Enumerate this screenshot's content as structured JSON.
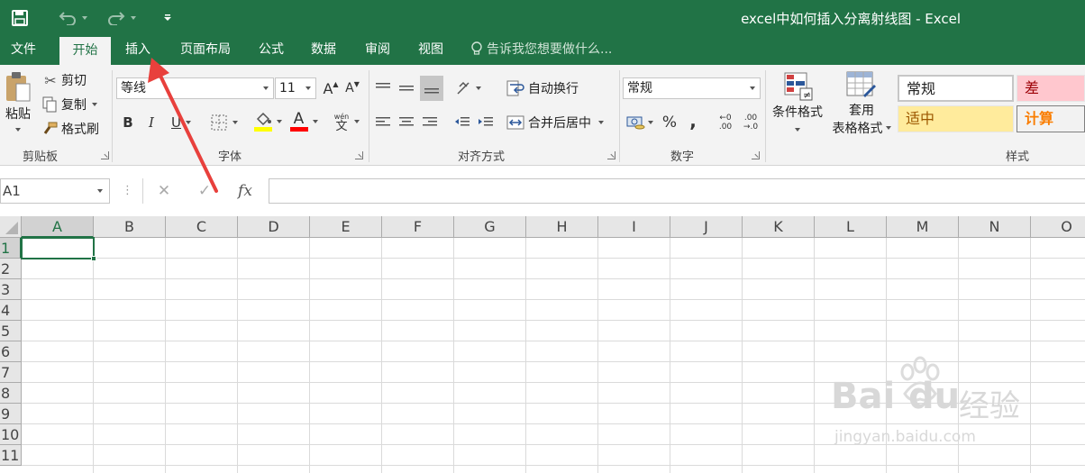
{
  "window": {
    "title": "excel中如何插入分离射线图 - Excel"
  },
  "qat": {
    "save_icon": "save-icon",
    "undo_icon": "undo-icon",
    "redo_icon": "redo-icon",
    "customize_icon": "customize-qat-icon"
  },
  "tabs": [
    {
      "label": "文件"
    },
    {
      "label": "开始"
    },
    {
      "label": "插入"
    },
    {
      "label": "页面布局"
    },
    {
      "label": "公式"
    },
    {
      "label": "数据"
    },
    {
      "label": "审阅"
    },
    {
      "label": "视图"
    }
  ],
  "tell_me": "告诉我您想要做什么...",
  "clipboard": {
    "paste": "粘贴",
    "cut": "剪切",
    "copy": "复制",
    "format_painter": "格式刷",
    "label": "剪贴板"
  },
  "font": {
    "font_name": "等线",
    "font_size": "11",
    "bold": "B",
    "italic": "I",
    "underline": "U",
    "font_color_glyph": "A",
    "phonetic_top": "wén",
    "phonetic_bottom": "文",
    "grow_glyph": "A",
    "shrink_glyph": "A",
    "label": "字体",
    "highlight_color": "#ffff00",
    "font_color": "#ff0000"
  },
  "alignment": {
    "wrap_text": "自动换行",
    "merge_center": "合并后居中",
    "label": "对齐方式"
  },
  "number": {
    "format": "常规",
    "percent": "%",
    "comma": ",",
    "inc_decimal_top": "←0",
    "inc_decimal_bottom": ".00",
    "dec_decimal_top": ".00",
    "dec_decimal_bottom": "→.0",
    "label": "数字"
  },
  "styles": {
    "conditional_formatting": "条件格式",
    "format_as_table_line1": "套用",
    "format_as_table_line2": "表格格式",
    "normal": "常规",
    "bad": "差",
    "neutral": "适中",
    "calculation": "计算",
    "label": "样式",
    "bad_bg": "#ffc7ce",
    "bad_fg": "#9c0006",
    "neutral_bg": "#ffeb9c",
    "neutral_fg": "#9c5700",
    "calc_bg": "#f2f2f2",
    "calc_fg": "#fa7d00"
  },
  "formula_bar": {
    "name_box": "A1",
    "cancel": "✕",
    "enter": "✓",
    "fx": "fx",
    "formula": ""
  },
  "grid": {
    "columns": [
      "A",
      "B",
      "C",
      "D",
      "E",
      "F",
      "G",
      "H",
      "I",
      "J",
      "K",
      "L",
      "M",
      "N",
      "O"
    ],
    "rows": [
      "1",
      "2",
      "3",
      "4",
      "5",
      "6",
      "7",
      "8",
      "9",
      "10",
      "11"
    ],
    "selected_cell": "A1"
  },
  "watermark": {
    "brand": "Bai",
    "brand2": "du",
    "cn": "经验",
    "url": "jingyan.baidu.com"
  },
  "colors": {
    "excel_green": "#217346",
    "annotation_red": "#e8403c"
  }
}
